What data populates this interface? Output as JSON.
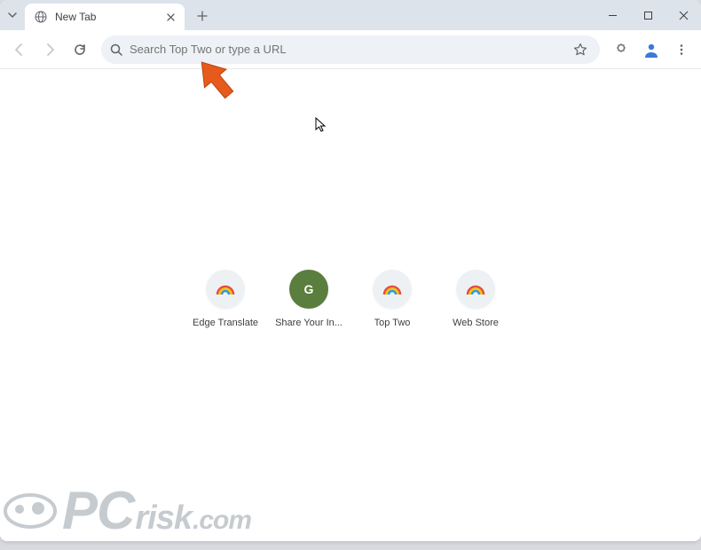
{
  "titlebar": {
    "tab_title": "New Tab"
  },
  "omnibox": {
    "placeholder": "Search Top Two or type a URL"
  },
  "shortcuts": [
    {
      "label": "Edge Translate",
      "icon": "rainbow"
    },
    {
      "label": "Share Your In...",
      "icon": "letter",
      "letter": "G"
    },
    {
      "label": "Top Two",
      "icon": "rainbow"
    },
    {
      "label": "Web Store",
      "icon": "rainbow"
    }
  ],
  "watermark": {
    "p": "P",
    "c": "C",
    "risk": "risk",
    "com": ".com"
  }
}
